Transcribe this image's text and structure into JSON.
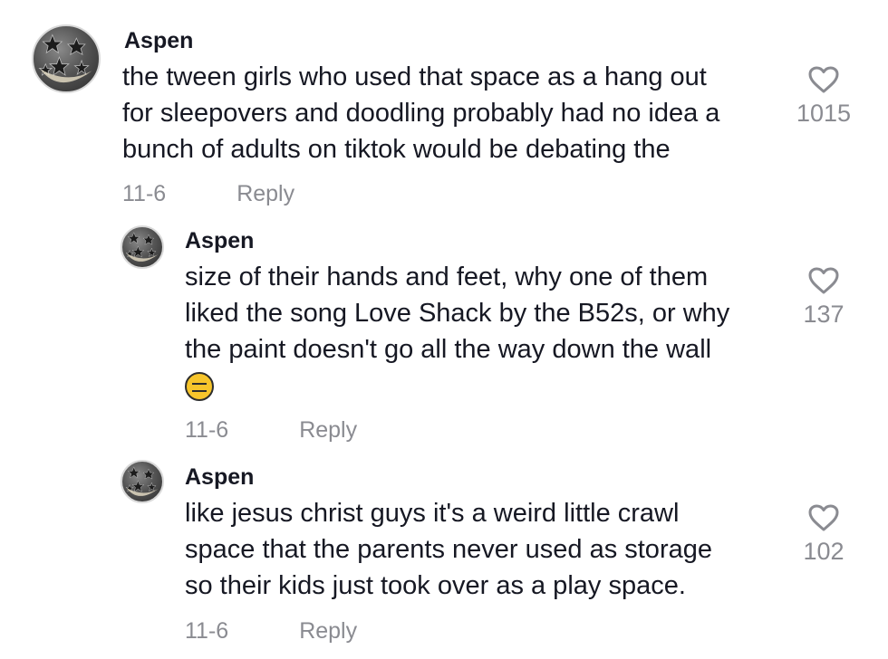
{
  "comments": [
    {
      "username": "Aspen",
      "lines": [
        "the tween girls who used that space as a hang out",
        "for sleepovers and doodling probably had no idea a",
        "bunch of adults on tiktok would be debating the"
      ],
      "date": "11-6",
      "reply_label": "Reply",
      "likes": "1015"
    },
    {
      "username": "Aspen",
      "lines": [
        "size of their hands and feet, why one of them",
        "liked the song Love Shack by the B52s, or why",
        "the paint doesn't go all the way down the wall"
      ],
      "emoji": "expressionless-face-icon",
      "date": "11-6",
      "reply_label": "Reply",
      "likes": "137"
    },
    {
      "username": "Aspen",
      "lines": [
        "like jesus christ guys it's a weird little crawl",
        "space that the parents never used as storage",
        "so their kids just took over as a play space."
      ],
      "date": "11-6",
      "reply_label": "Reply",
      "likes": "102"
    }
  ],
  "colors": {
    "text": "#161823",
    "muted": "#8a8b91",
    "heart_outline": "#8a8b91",
    "emoji_fill": "#f7c52b"
  }
}
